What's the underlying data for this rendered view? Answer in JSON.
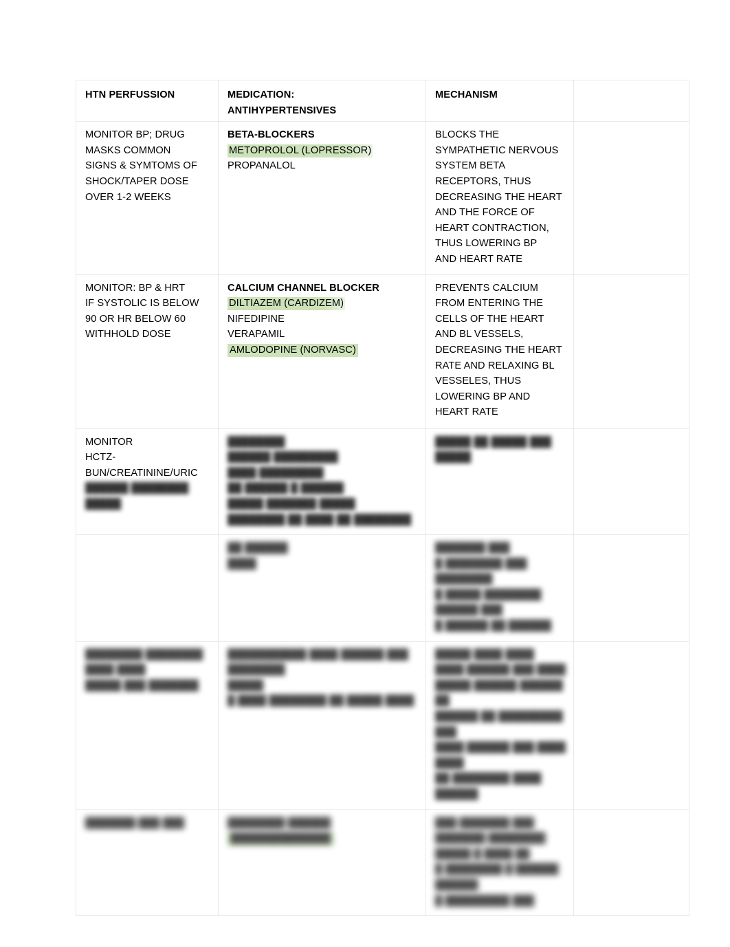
{
  "document": {
    "type": "study-table",
    "title_visible": false,
    "highlight_color": "#c9e0b4",
    "border_color": "#e8e8e8",
    "background_color": "#ffffff"
  },
  "table": {
    "columns": [
      {
        "key": "col1",
        "header": "HTN PERFUSSION"
      },
      {
        "key": "col2",
        "header": "MEDICATION:\nANTIHYPERTENSIVES"
      },
      {
        "key": "col3",
        "header": "MECHANISM"
      },
      {
        "key": "col4",
        "header": ""
      }
    ],
    "rows": [
      {
        "id": "row-beta-blockers",
        "legible": true,
        "col1": {
          "lines": [
            "MONITOR BP; DRUG",
            "MASKS COMMON",
            "SIGNS & SYMTOMS OF",
            "SHOCK/TAPER DOSE",
            "OVER 1-2 WEEKS"
          ]
        },
        "col2": {
          "heading": "BETA-BLOCKERS",
          "items": [
            {
              "text": "METOPROLOL (LOPRESSOR)",
              "highlighted": true
            },
            {
              "text": "PROPANALOL",
              "highlighted": false
            }
          ]
        },
        "col3": {
          "lines": [
            "BLOCKS THE",
            "SYMPATHETIC NERVOUS",
            "SYSTEM BETA",
            "RECEPTORS, THUS",
            "DECREASING THE HEART",
            "AND THE FORCE OF",
            "HEART CONTRACTION,",
            "THUS LOWERING BP",
            "AND HEART RATE"
          ]
        },
        "col4": {
          "lines": []
        }
      },
      {
        "id": "row-calcium-channel-blockers",
        "legible": true,
        "col1": {
          "lines": [
            "MONITOR: BP & HRT",
            "IF SYSTOLIC IS BELOW",
            "90 OR HR BELOW 60",
            "WITHHOLD DOSE"
          ]
        },
        "col2": {
          "heading": "CALCIUM CHANNEL BLOCKER",
          "items": [
            {
              "text": "DILTIAZEM (CARDIZEM)",
              "highlighted": true
            },
            {
              "text": "NIFEDIPINE",
              "highlighted": false
            },
            {
              "text": "VERAPAMIL",
              "highlighted": false
            },
            {
              "text": "AMLODOPINE (NORVASC)",
              "highlighted": true
            }
          ]
        },
        "col3": {
          "lines": [
            "PREVENTS CALCIUM",
            "FROM ENTERING THE",
            "CELLS OF THE HEART",
            "AND BL VESSELS,",
            "DECREASING THE HEART",
            "RATE AND RELAXING BL",
            "VESSELES, THUS",
            "LOWERING BP AND",
            "HEART RATE"
          ]
        },
        "col4": {
          "lines": []
        }
      },
      {
        "id": "row-diuretics",
        "legible": "partial",
        "col1": {
          "lines": [
            "MONITOR",
            "HCTZ-",
            "BUN/CREATININE/URIC"
          ],
          "obscured_lines": [
            "██████ ████████",
            "█████"
          ]
        },
        "col2": {
          "obscured_lines": [
            "████████",
            "██████ █████████",
            "████ █████████",
            "██ ██████ █ ██████",
            "█████ ███████ █████",
            "████████ ██ ████ ██ ████████"
          ]
        },
        "col3": {
          "obscured_lines": [
            "█████ ██ █████ ███ █████"
          ]
        },
        "col4": {
          "lines": []
        }
      },
      {
        "id": "row-obscured-2",
        "legible": false,
        "col1": {
          "obscured_lines": []
        },
        "col2": {
          "obscured_lines": [
            "██ ██████",
            "████"
          ]
        },
        "col3": {
          "obscured_lines": [
            "███████ ███",
            "█ ████████ ███",
            "████████",
            "█ █████ ████████",
            "██████ ███",
            "█ ██████ ██ ██████"
          ]
        },
        "col4": {
          "lines": []
        }
      },
      {
        "id": "row-obscured-3",
        "legible": false,
        "col1": {
          "obscured_lines": [
            "████████ ████████",
            "████ ████",
            "█████ ███ ███████"
          ]
        },
        "col2": {
          "obscured_lines": [
            "███████████ ████ ██████ ███ ████████",
            "█████",
            "█ ████ ████████ ██ █████ ████"
          ]
        },
        "col3": {
          "obscured_lines": [
            "█████ ████ ████",
            "████ ██████ ███ ████",
            "█████ ██████ ██████ ██",
            "██████ ██ █████████ ███",
            "████ ██████ ███ ████ ████",
            "██ ████████ ████ ██████"
          ]
        },
        "col4": {
          "lines": []
        }
      },
      {
        "id": "row-obscured-4",
        "legible": false,
        "col1": {
          "obscured_lines": [
            "███████ ███ ███"
          ]
        },
        "col2": {
          "obscured_lines": [
            "████████ ██████"
          ],
          "highlighted_obscured": "██████████████"
        },
        "col3": {
          "obscured_lines": [
            "███ ███████ ███",
            "███████ ████████",
            "█████ █ ████ ██",
            "█ ████████ █ ██████ ██████",
            "█ █████████ ███"
          ]
        },
        "col4": {
          "lines": []
        }
      }
    ]
  }
}
